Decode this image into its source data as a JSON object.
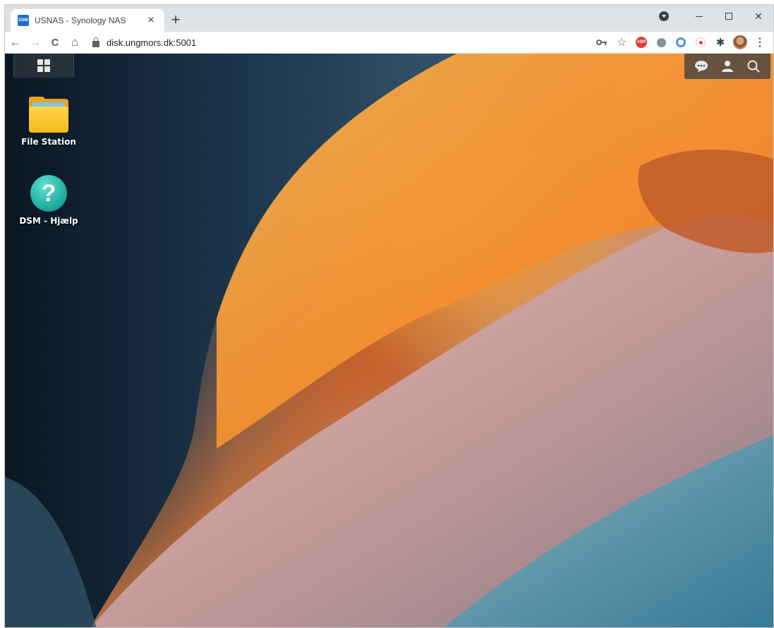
{
  "browser": {
    "tab": {
      "favicon_text": "DSM",
      "title": "USNAS - Synology NAS",
      "close_glyph": "×"
    },
    "new_tab_glyph": "+",
    "address": "disk.ungmors.dk:5001",
    "extensions": {
      "abp_text": "ABP"
    },
    "icons": {
      "back": "←",
      "forward": "→",
      "reload": "C",
      "home": "⌂",
      "key": "🔑",
      "star": "☆",
      "puzzle": "✱",
      "kebab": "⋮",
      "close_window": "✕"
    }
  },
  "desktop": {
    "icons": [
      {
        "label": "File Station"
      },
      {
        "label": "DSM - Hjælp",
        "glyph": "?"
      }
    ]
  }
}
